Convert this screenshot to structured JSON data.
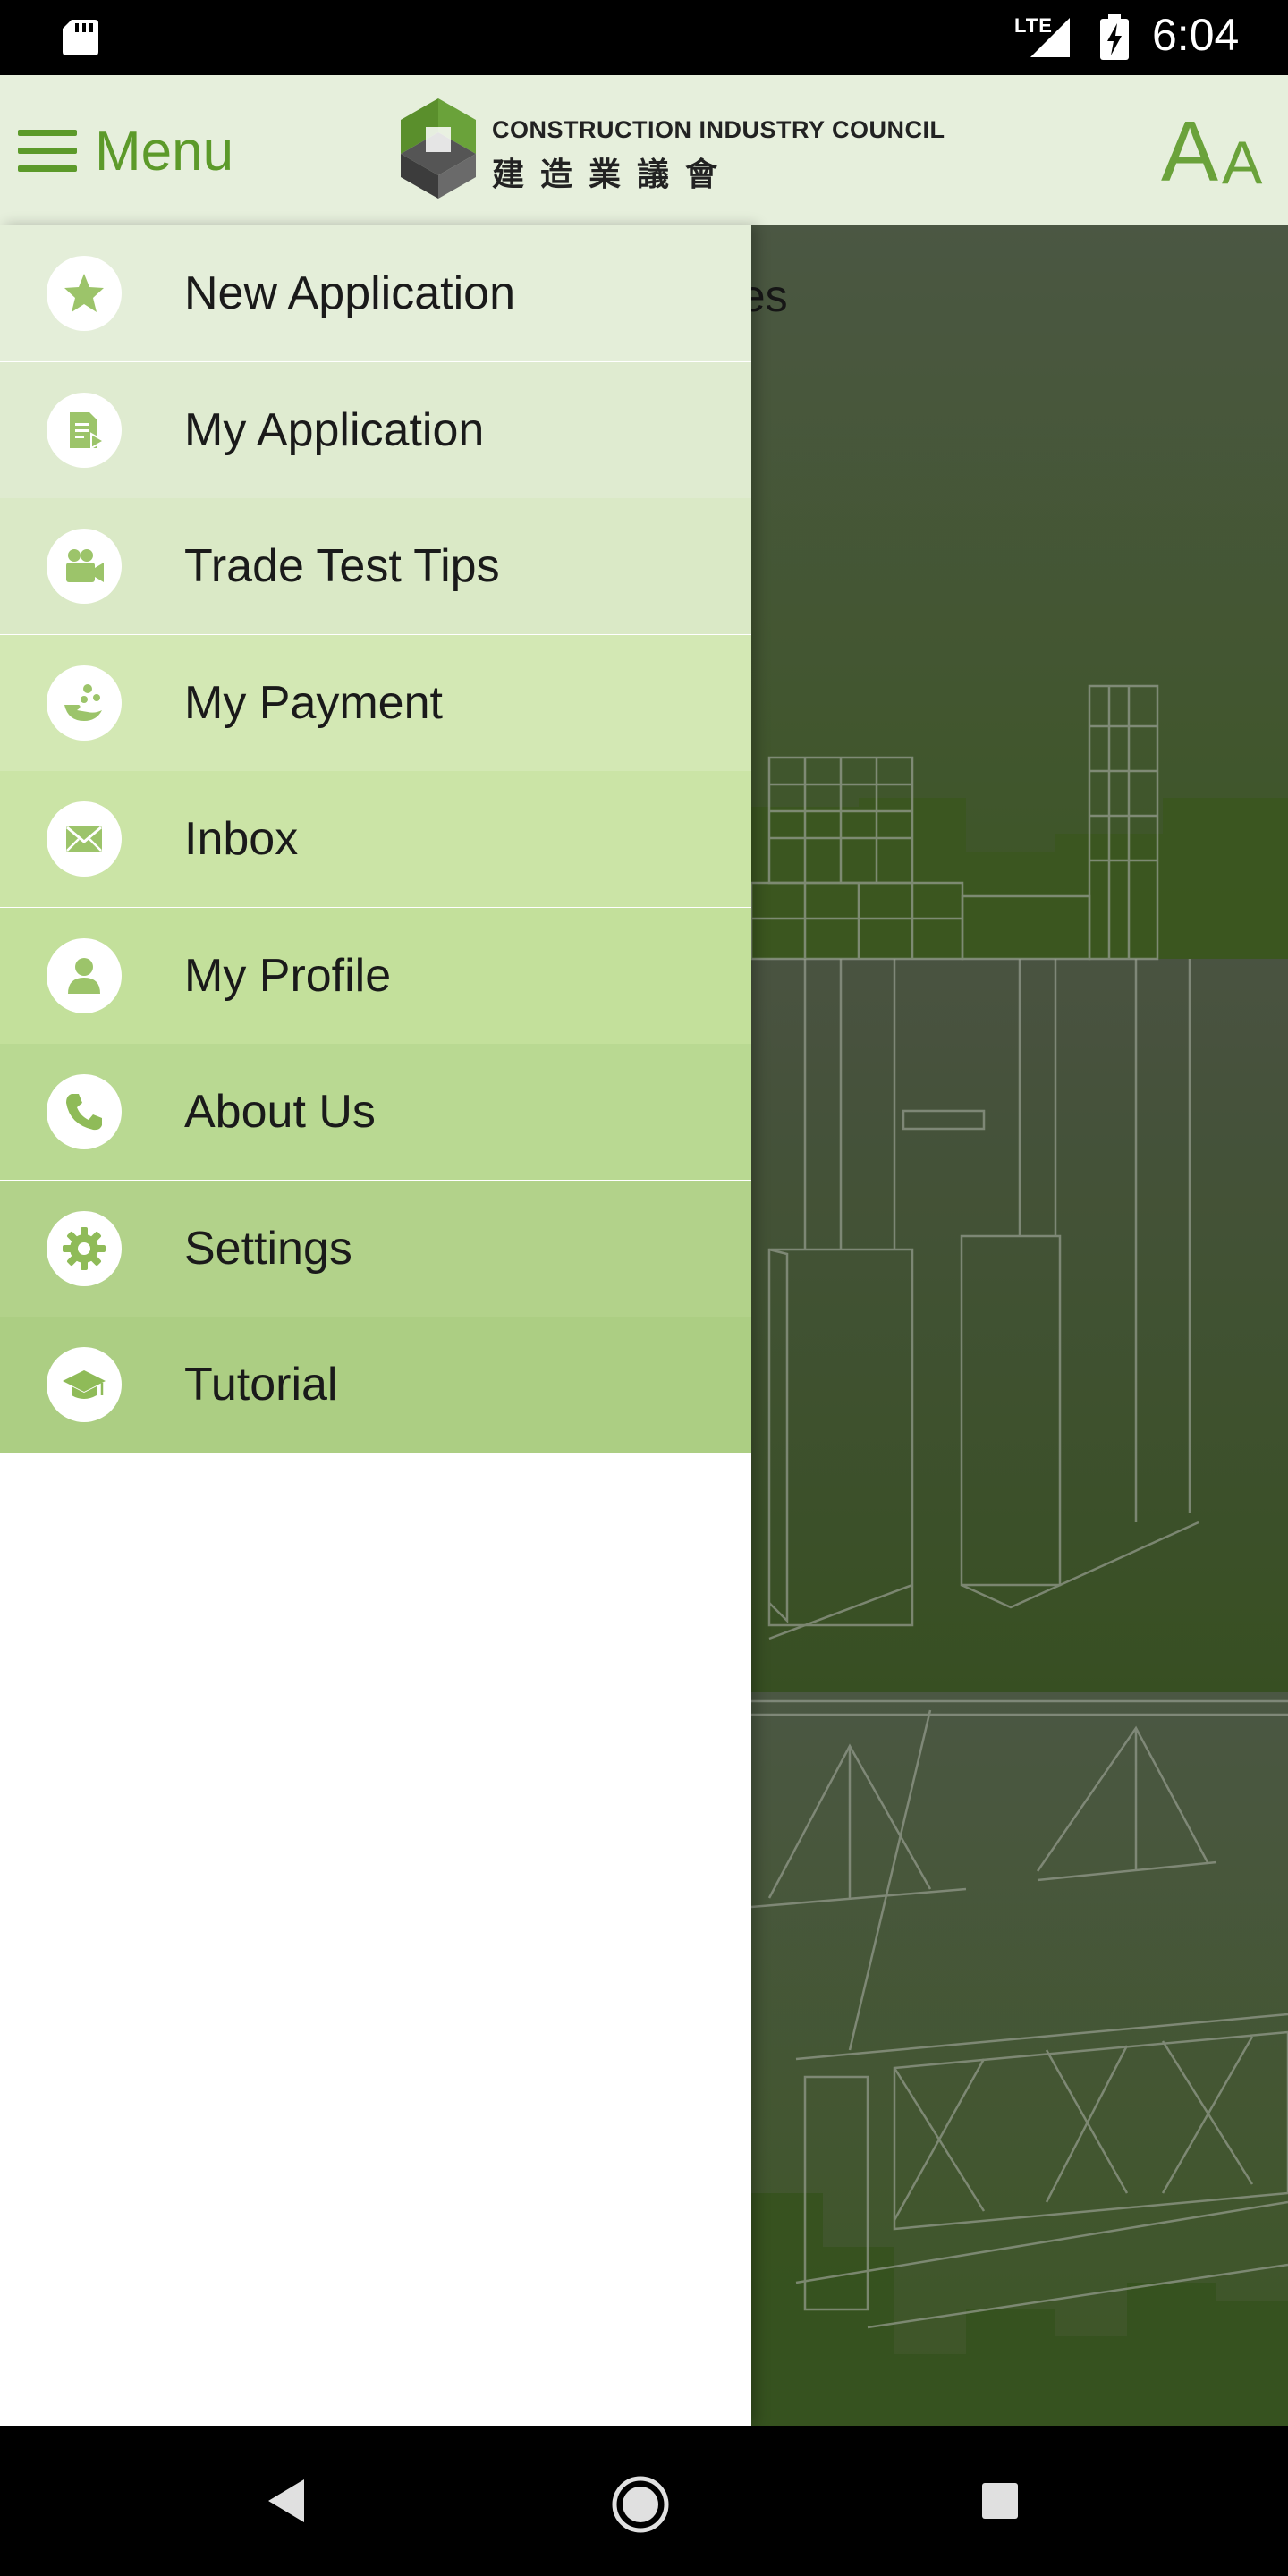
{
  "status_bar": {
    "network": "LTE",
    "time": "6:04",
    "icons": [
      "sd-card-icon",
      "signal-icon",
      "battery-charging-icon"
    ]
  },
  "app_bar": {
    "menu_label": "Menu",
    "menu_icon": "hamburger-icon",
    "logo_title_en": "CONSTRUCTION INDUSTRY COUNCIL",
    "logo_title_zh": "建造業議會",
    "font_size_big": "A",
    "font_size_small": "A"
  },
  "background": {
    "partial_text": "des"
  },
  "drawer": {
    "items": [
      {
        "label": "New Application",
        "icon": "star-icon",
        "color": "#e4eed9"
      },
      {
        "label": "My Application",
        "icon": "document-icon",
        "color": "#dfebd0"
      },
      {
        "label": "Trade Test Tips",
        "icon": "video-camera-icon",
        "color": "#dae9c6"
      },
      {
        "label": "My Payment",
        "icon": "payment-hand-icon",
        "color": "#d3e8b4"
      },
      {
        "label": "Inbox",
        "icon": "envelope-icon",
        "color": "#cbe4a6"
      },
      {
        "label": "My Profile",
        "icon": "person-icon",
        "color": "#c3e09b"
      },
      {
        "label": "About Us",
        "icon": "phone-icon",
        "color": "#b9d992"
      },
      {
        "label": "Settings",
        "icon": "gear-icon",
        "color": "#b2d28a"
      },
      {
        "label": "Tutorial",
        "icon": "graduation-cap-icon",
        "color": "#acce83"
      }
    ]
  },
  "colors": {
    "brand_green": "#5c9a2a",
    "app_bar_bg": "#e6efdc",
    "icon_green": "#9cc46a"
  }
}
